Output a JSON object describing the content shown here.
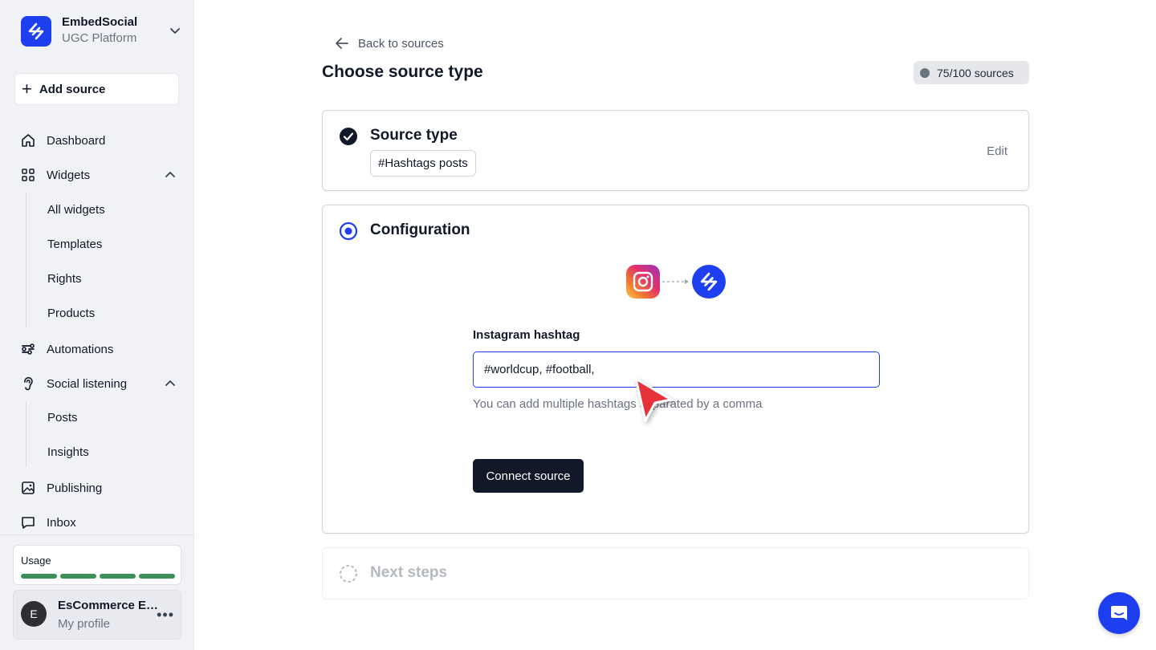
{
  "brand": {
    "name": "EmbedSocial",
    "subtitle": "UGC Platform"
  },
  "sidebar": {
    "add_source": "Add source",
    "items": {
      "dashboard": "Dashboard",
      "widgets": "Widgets",
      "all_widgets": "All widgets",
      "templates": "Templates",
      "rights": "Rights",
      "products": "Products",
      "automations": "Automations",
      "social_listening": "Social listening",
      "posts": "Posts",
      "insights": "Insights",
      "publishing": "Publishing",
      "inbox": "Inbox"
    },
    "usage": {
      "label": "Usage",
      "segments_filled": 4,
      "segments_total": 4
    },
    "profile": {
      "initial": "E",
      "name": "EsCommerce E…",
      "subtitle": "My profile"
    }
  },
  "header": {
    "back_label": "Back to sources",
    "title": "Choose source type",
    "quota": "75/100 sources"
  },
  "steps": {
    "source_type": {
      "title": "Source type",
      "value": "#Hashtags posts",
      "edit": "Edit"
    },
    "configuration": {
      "title": "Configuration",
      "field_label": "Instagram hashtag",
      "field_value": "#worldcup, #football,",
      "helper": "You can add multiple hashtags separated by a comma",
      "connect": "Connect source"
    },
    "next": {
      "title": "Next steps"
    }
  },
  "colors": {
    "accent": "#1d3ff0",
    "dark_button": "#111827",
    "usage_bar": "#3b8f57",
    "pointer": "#e8303a"
  }
}
